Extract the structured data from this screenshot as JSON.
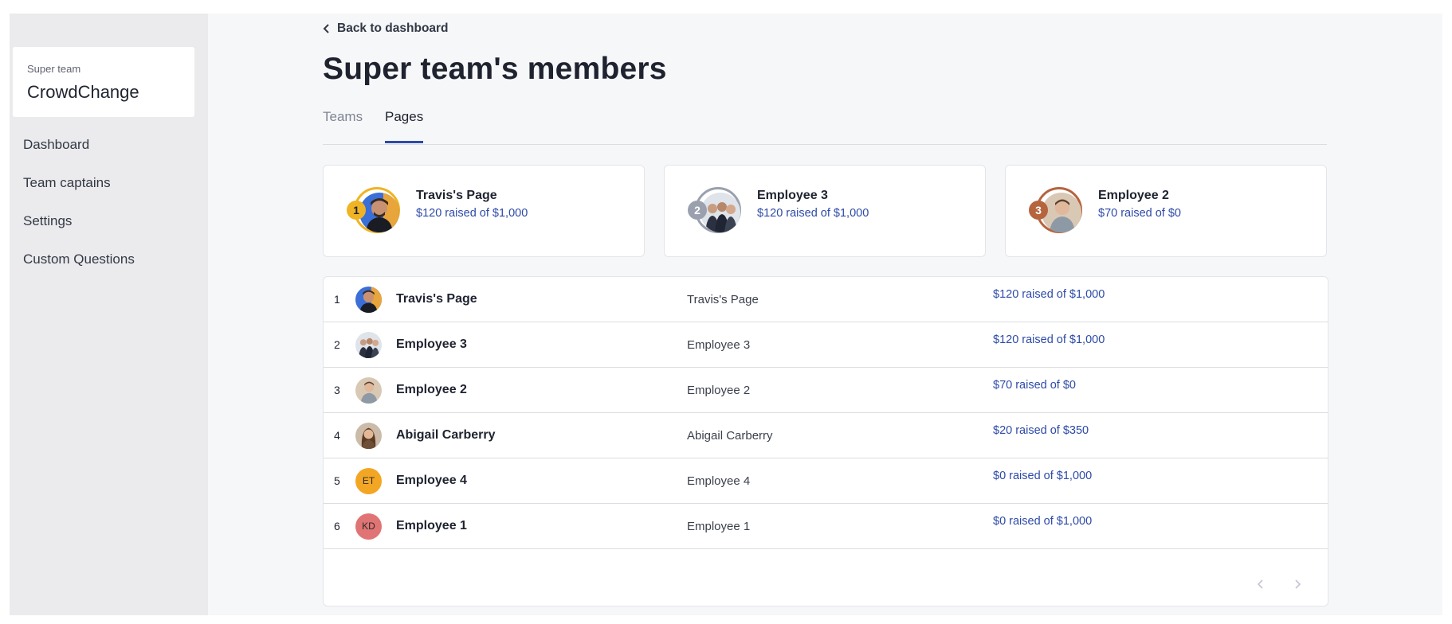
{
  "sidebar": {
    "team_label": "Super team",
    "team_name": "CrowdChange",
    "items": [
      {
        "label": "Dashboard"
      },
      {
        "label": "Team captains"
      },
      {
        "label": "Settings"
      },
      {
        "label": "Custom Questions"
      }
    ]
  },
  "header": {
    "back_label": "Back to dashboard",
    "title": "Super team's members"
  },
  "tabs": [
    {
      "label": "Teams",
      "active": false
    },
    {
      "label": "Pages",
      "active": true
    }
  ],
  "top3": [
    {
      "rank": "1",
      "name": "Travis's Page",
      "raised": "$120 raised of $1,000",
      "ring_color": "#f0b323"
    },
    {
      "rank": "2",
      "name": "Employee 3",
      "raised": "$120 raised of $1,000",
      "ring_color": "#9aa0ad"
    },
    {
      "rank": "3",
      "name": "Employee 2",
      "raised": "$70 raised of $0",
      "ring_color": "#b5643d"
    }
  ],
  "rows": [
    {
      "rank": "1",
      "name": "Travis's Page",
      "page": "Travis's Page",
      "raised": "$120 raised of $1,000",
      "avatar": "photo"
    },
    {
      "rank": "2",
      "name": "Employee 3",
      "page": "Employee 3",
      "raised": "$120 raised of $1,000",
      "avatar": "photo"
    },
    {
      "rank": "3",
      "name": "Employee 2",
      "page": "Employee 2",
      "raised": "$70 raised of $0",
      "avatar": "photo"
    },
    {
      "rank": "4",
      "name": "Abigail Carberry",
      "page": "Abigail Carberry",
      "raised": "$20 raised of $350",
      "avatar": "photo"
    },
    {
      "rank": "5",
      "name": "Employee 4",
      "page": "Employee 4",
      "raised": "$0 raised of $1,000",
      "avatar": "ET",
      "avatar_color": "#f3a623"
    },
    {
      "rank": "6",
      "name": "Employee 1",
      "page": "Employee 1",
      "raised": "$0 raised of $1,000",
      "avatar": "KD",
      "avatar_color": "#e07474"
    }
  ],
  "icons": {
    "back": "chevron-left-icon",
    "pager_prev": "chevron-left-icon",
    "pager_next": "chevron-right-icon"
  },
  "colors": {
    "accent": "#2d4aa8",
    "gold": "#f0b323",
    "silver": "#9aa0ad",
    "bronze": "#b5643d"
  }
}
